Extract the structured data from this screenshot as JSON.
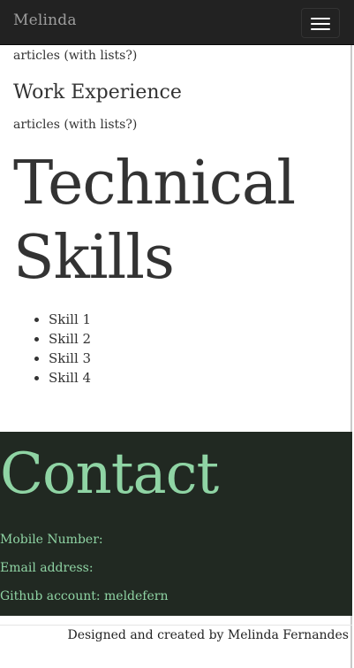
{
  "navbar": {
    "brand": "Melinda",
    "menu_icon": "hamburger-menu-icon"
  },
  "sections": {
    "education_text": "articles (with lists?)",
    "work": {
      "heading": "Work Experience",
      "text": "articles (with lists?)"
    },
    "skills": {
      "heading": "Technical Skills",
      "items": [
        "Skill 1",
        "Skill 2",
        "Skill 3",
        "Skill 4"
      ]
    }
  },
  "contact": {
    "heading": "Contact",
    "mobile": "Mobile Number:",
    "email": "Email address:",
    "github": "Github account: meldefern"
  },
  "footer": {
    "credit": "Designed and created by Melinda Fernandes"
  },
  "colors": {
    "navbar_bg": "#222222",
    "contact_bg": "#212922",
    "contact_accent": "#8fd4a4",
    "text": "#333333"
  }
}
